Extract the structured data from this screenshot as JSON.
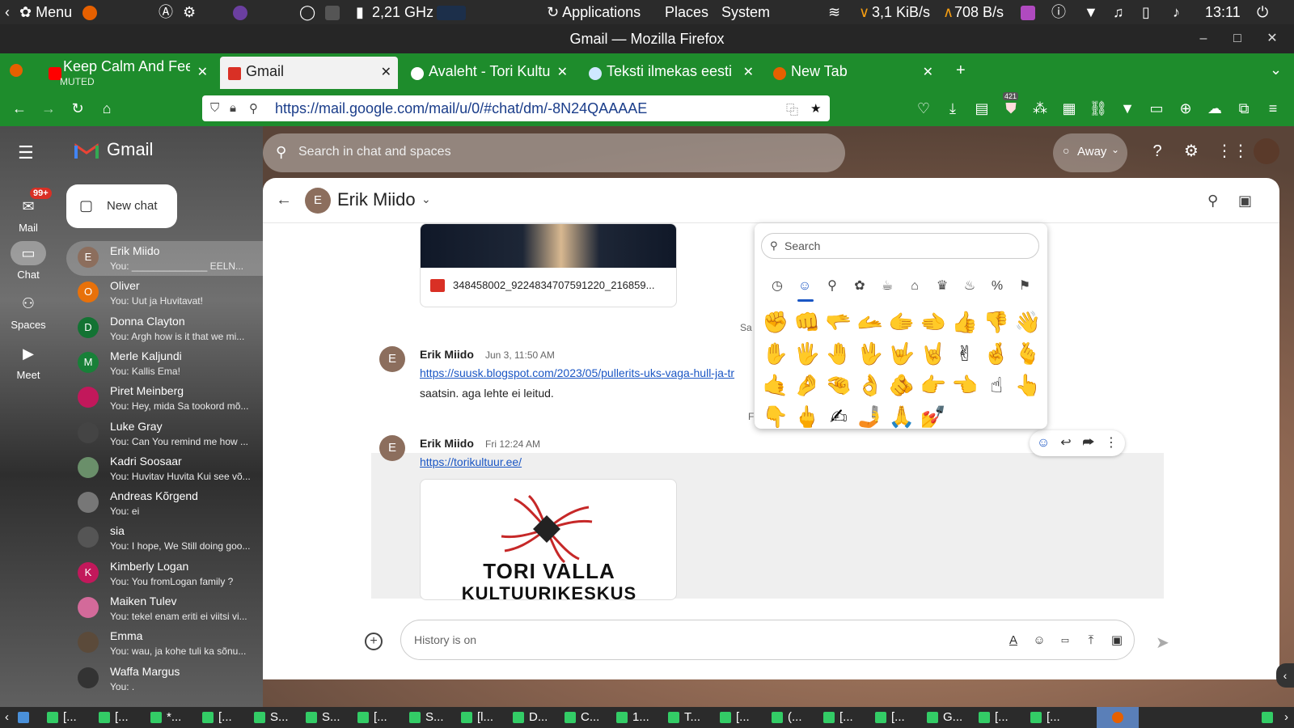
{
  "system": {
    "menu_label": "Menu",
    "cpu_freq": "2,21 GHz",
    "applications": "Applications",
    "places": "Places",
    "system": "System",
    "net_down": "3,1 KiB/s",
    "net_up": "708 B/s",
    "clock": "13:11"
  },
  "window": {
    "title": "Gmail — Mozilla Firefox"
  },
  "tabs": [
    {
      "label": "Keep Calm And Feel",
      "sub": "MUTED"
    },
    {
      "label": "Gmail"
    },
    {
      "label": "Avaleht - Tori Kultuu"
    },
    {
      "label": "Teksti ilmekas eesti"
    },
    {
      "label": "New Tab"
    }
  ],
  "nav": {
    "url": "https://mail.google.com/mail/u/0/#chat/dm/-8N24QAAAAE",
    "ext_badge": "421"
  },
  "gmail": {
    "logo_text": "Gmail",
    "search_placeholder": "Search in chat and spaces",
    "status": "Away",
    "new_chat": "New chat",
    "rail": [
      {
        "label": "Mail",
        "badge": "99+"
      },
      {
        "label": "Chat"
      },
      {
        "label": "Spaces"
      },
      {
        "label": "Meet"
      }
    ],
    "conversations": [
      {
        "initial": "E",
        "name": "Erik Miido",
        "preview": "You: ______________ EELN...",
        "color": "#8c6e5d"
      },
      {
        "initial": "O",
        "name": "Oliver",
        "preview": "You: Uut ja Huvitavat!",
        "color": "#e8710a"
      },
      {
        "initial": "D",
        "name": "Donna Clayton",
        "preview": "You: Argh how is it that we mi...",
        "color": "#137333"
      },
      {
        "initial": "M",
        "name": "Merle Kaljundi",
        "preview": "You: Kallis Ema!",
        "color": "#188038"
      },
      {
        "initial": "",
        "name": "Piret Meinberg",
        "preview": "You: Hey, mida Sa tookord mõ...",
        "color": "#c2185b"
      },
      {
        "initial": "",
        "name": "Luke Gray",
        "preview": "You: Can You remind me how ...",
        "color": "#444444"
      },
      {
        "initial": "",
        "name": "Kadri Soosaar",
        "preview": "You: Huvitav Huvita Kui see võ...",
        "color": "#6a8f6a"
      },
      {
        "initial": "",
        "name": "Andreas Kõrgend",
        "preview": "You: ei",
        "color": "#777777"
      },
      {
        "initial": "",
        "name": "sia",
        "preview": "You: I hope, We Still doing goo...",
        "color": "#555555"
      },
      {
        "initial": "K",
        "name": "Kimberly Logan",
        "preview": "You: You fromLogan family ?",
        "color": "#c2185b"
      },
      {
        "initial": "",
        "name": "Maiken Tulev",
        "preview": "You: tekel enam eriti ei viitsi vi...",
        "color": "#d36a9a"
      },
      {
        "initial": "",
        "name": "Emma",
        "preview": "You: wau, ja kohe tuli ka sõnu...",
        "color": "#5b4a3a"
      },
      {
        "initial": "",
        "name": "Waffa Margus",
        "preview": "You: .",
        "color": "#333333"
      }
    ]
  },
  "chat": {
    "contact_initial": "E",
    "contact_name": "Erik Miido",
    "file_name": "348458002_9224834707591220_216859...",
    "date_sep_1": "Sa",
    "date_sep_2": "F",
    "messages": [
      {
        "initial": "E",
        "name": "Erik Miido",
        "time": "Jun 3, 11:50 AM",
        "link": "https://suusk.blogspot.com/2023/05/pullerits-uks-vaga-hull-ja-tr",
        "text": "saatsin. aga lehte ei leitud."
      },
      {
        "initial": "E",
        "name": "Erik Miido",
        "time": "Fri 12:24 AM",
        "link": "https://torikultuur.ee/"
      }
    ],
    "preview_line1": "TORI VALLA",
    "preview_line2": "KULTUURIKESKUS",
    "compose_placeholder": "History is on"
  },
  "emoji_picker": {
    "search_placeholder": "Search",
    "categories": [
      "recent-icon",
      "smiley-icon",
      "person-icon",
      "animal-icon",
      "food-icon",
      "travel-icon",
      "activity-icon",
      "object-icon",
      "symbol-icon",
      "flag-icon"
    ],
    "rows": [
      [
        "✊",
        "👊",
        "🫳",
        "🫴",
        "🫱",
        "🫲",
        "👍",
        "👎",
        "👋"
      ],
      [
        "✋",
        "🖐",
        "🤚",
        "🖖",
        "🤟",
        "🤘",
        "✌",
        "🤞",
        "🫰"
      ],
      [
        "🤙",
        "🤌",
        "🤏",
        "👌",
        "🫵",
        "👉",
        "👈",
        "☝",
        "👆"
      ],
      [
        "👇",
        "🖕",
        "✍",
        "🤳",
        "🙏",
        "💅"
      ]
    ]
  },
  "taskbar": [
    {
      "label": "[..."
    },
    {
      "label": "[..."
    },
    {
      "label": "*..."
    },
    {
      "label": "[..."
    },
    {
      "label": "S..."
    },
    {
      "label": "S..."
    },
    {
      "label": "[..."
    },
    {
      "label": "S..."
    },
    {
      "label": "[l..."
    },
    {
      "label": "D..."
    },
    {
      "label": "C..."
    },
    {
      "label": "1..."
    },
    {
      "label": "T..."
    },
    {
      "label": "[..."
    },
    {
      "label": "(..."
    },
    {
      "label": "[..."
    },
    {
      "label": "[..."
    },
    {
      "label": "G..."
    },
    {
      "label": "[..."
    },
    {
      "label": "[..."
    }
  ]
}
